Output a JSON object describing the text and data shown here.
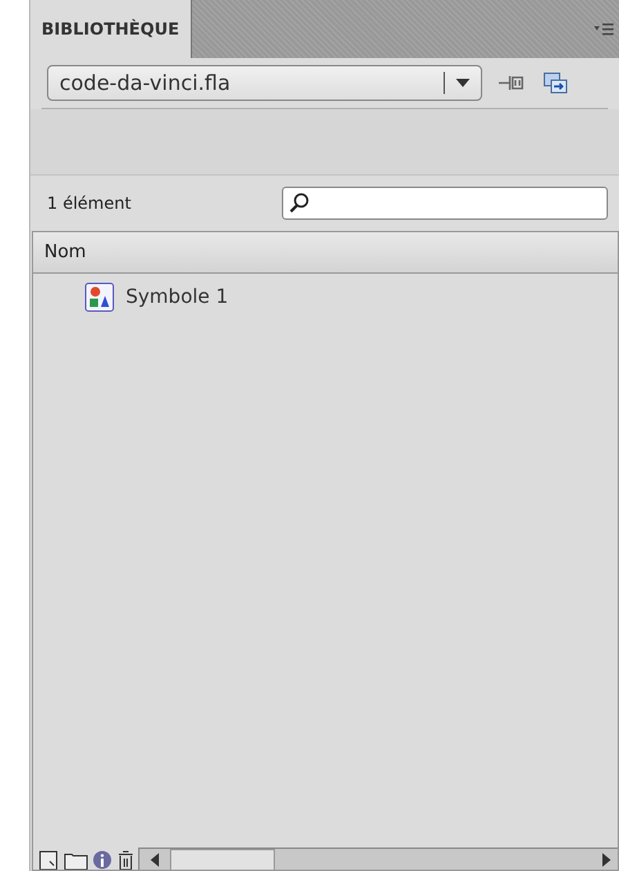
{
  "panel_tab": {
    "label": "BIBLIOTHÈQUE",
    "selected": true
  },
  "document_select": {
    "value": "code-da-vinci.fla"
  },
  "item_count": "1 élément",
  "table": {
    "columns": [
      "Nom"
    ],
    "rows": [
      {
        "name": "Symbole 1",
        "selected": false
      }
    ]
  }
}
